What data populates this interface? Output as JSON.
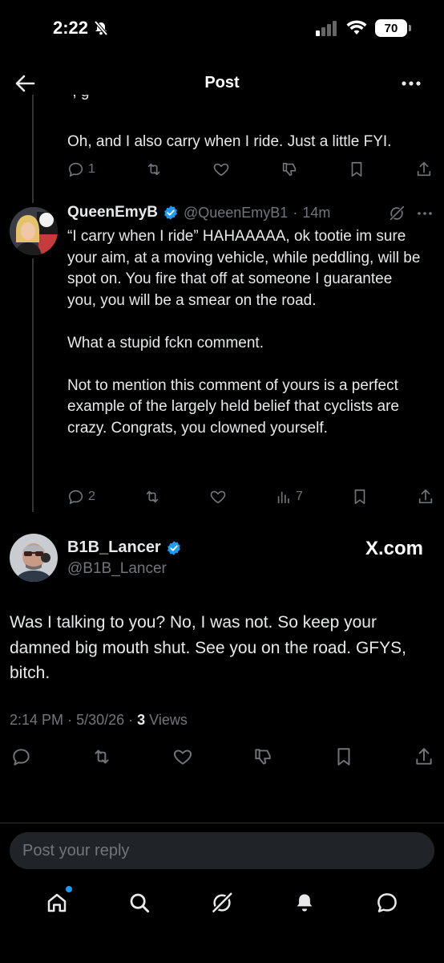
{
  "status_bar": {
    "time": "2:22",
    "battery": "70"
  },
  "header": {
    "title": "Post"
  },
  "parent_post": {
    "text": "Oh, and I also carry when I ride. Just a little FYI.",
    "reply_count": "1"
  },
  "reply_post": {
    "display_name": "QueenEmyB",
    "handle": "@QueenEmyB1",
    "time": "14m",
    "text": "“I carry when I ride” HAHAAAAA, ok tootie im sure your aim, at a moving vehicle, while peddling, will be spot on. You fire that off at someone I guarantee you, you will be a smear on the road.\n\nWhat a stupid fckn comment.\n\nNot to mention this comment of yours is a perfect example of the largely held belief that cyclists are crazy. Congrats, you clowned yourself.",
    "reply_count": "2",
    "views": "7"
  },
  "main_post": {
    "display_name": "B1B_Lancer",
    "handle": "@B1B_Lancer",
    "watermark": "X.com",
    "text": "Was I talking to you? No, I was not. So keep your damned big mouth shut. See you on the road. GFYS, bitch.",
    "time": "2:14 PM",
    "date": "5/30/26",
    "views_count": "3",
    "views_label": "Views"
  },
  "reply_box": {
    "placeholder": "Post your reply"
  },
  "colors": {
    "background": "#000000",
    "text": "#e7e9ea",
    "muted": "#71767b",
    "verified": "#1d9bf0",
    "notification_dot": "#1d9bf0"
  },
  "icons": [
    "back-arrow-icon",
    "more-icon",
    "reply-icon",
    "repost-icon",
    "like-icon",
    "dislike-icon",
    "views-icon",
    "bookmark-icon",
    "share-icon",
    "grok-icon",
    "home-icon",
    "search-icon",
    "bell-icon",
    "messages-icon"
  ]
}
